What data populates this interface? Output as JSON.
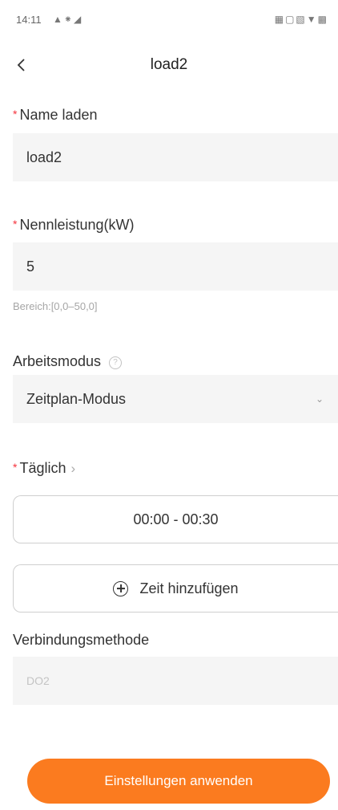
{
  "status_bar": {
    "time": "14:11",
    "left_icons": [
      "notification-icon",
      "bluetooth-icon",
      "signal-icon"
    ],
    "right_icons": [
      "network-icon",
      "battery-saver-icon",
      "sim-icon",
      "wifi-icon",
      "battery-icon"
    ]
  },
  "header": {
    "back_icon": "chevron-left-icon",
    "title": "load2"
  },
  "form": {
    "name": {
      "label": "Name laden",
      "required": true,
      "value": "load2"
    },
    "power": {
      "label": "Nennleistung(kW)",
      "required": true,
      "value": "5",
      "hint": "Bereich:[0,0–50,0]"
    },
    "mode": {
      "label": "Arbeitsmodus",
      "help_icon": "question-circle-icon",
      "value": "Zeitplan-Modus",
      "dropdown_icon": "chevron-down-icon"
    },
    "daily": {
      "label": "Täglich",
      "required": true,
      "chevron_icon": "chevron-right-icon"
    },
    "time_slots": [
      {
        "range": "00:00 - 00:30"
      }
    ],
    "add_time": {
      "label": "Zeit hinzufügen",
      "icon": "plus-circle-icon"
    },
    "connection": {
      "label": "Verbindungsmethode",
      "value": "DO2"
    }
  },
  "footer": {
    "apply_label": "Einstellungen anwenden"
  },
  "colors": {
    "accent": "#fb7b1f",
    "required_mark": "#f5323c",
    "field_background": "#f5f5f5"
  }
}
